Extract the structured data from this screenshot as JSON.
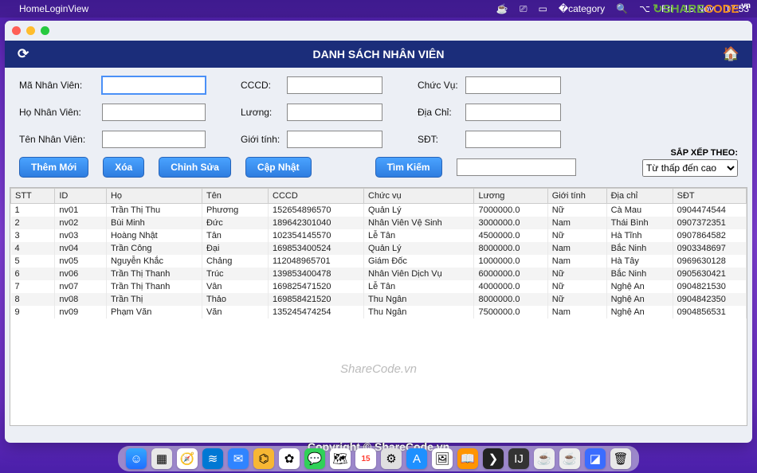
{
  "menubar": {
    "app_name": "HomeLoginView",
    "day": "Fri",
    "date": "15 Nov",
    "time": "17:53"
  },
  "logo": {
    "text1": "SHARE",
    "text2": "CODE",
    "suffix": ".vn"
  },
  "titlebar": {
    "title": "DANH SÁCH NHÂN VIÊN"
  },
  "form": {
    "labels": {
      "ma_nv": "Mã Nhân Viên:",
      "ho_nv": "Họ Nhân Viên:",
      "ten_nv": "Tên Nhân Viên:",
      "cccd": "CCCD:",
      "luong": "Lương:",
      "gioi_tinh": "Giới tính:",
      "chuc_vu": "Chức Vụ:",
      "dia_chi": "Địa Chỉ:",
      "sdt": "SĐT:"
    }
  },
  "buttons": {
    "them_moi": "Thêm Mới",
    "xoa": "Xóa",
    "chinh_sua": "Chỉnh Sửa",
    "cap_nhat": "Cập Nhật",
    "tim_kiem": "Tìm Kiếm"
  },
  "sort": {
    "label": "SẮP XẾP THEO:",
    "selected": "Từ thấp đến cao"
  },
  "table": {
    "headers": [
      "STT",
      "ID",
      "Họ",
      "Tên",
      "CCCD",
      "Chức vụ",
      "Lương",
      "Giới tính",
      "Địa chỉ",
      "SĐT"
    ],
    "rows": [
      [
        "1",
        "nv01",
        "Trần Thị Thu",
        "Phương",
        "152654896570",
        "Quản Lý",
        "7000000.0",
        "Nữ",
        "Cà Mau",
        "0904474544"
      ],
      [
        "2",
        "nv02",
        "Bùi Minh",
        "Đức",
        "189642301040",
        "Nhân Viên Vệ Sinh",
        "3000000.0",
        "Nam",
        "Thái Bình",
        "0907372351"
      ],
      [
        "3",
        "nv03",
        "Hoàng Nhật",
        "Tân",
        "102354145570",
        "Lễ Tân",
        "4500000.0",
        "Nữ",
        "Hà Tĩnh",
        "0907864582"
      ],
      [
        "4",
        "nv04",
        "Trần Công",
        "Đại",
        "169853400524",
        "Quản Lý",
        "8000000.0",
        "Nam",
        "Bắc Ninh",
        "0903348697"
      ],
      [
        "5",
        "nv05",
        "Nguyễn Khắc",
        "Chảng",
        "112048965701",
        "Giám Đốc",
        "1000000.0",
        "Nam",
        "Hà Tây",
        "0969630128"
      ],
      [
        "6",
        "nv06",
        "Trần Thị Thanh",
        "Trúc",
        "139853400478",
        "Nhân Viên Dịch Vụ",
        "6000000.0",
        "Nữ",
        "Bắc Ninh",
        "0905630421"
      ],
      [
        "7",
        "nv07",
        "Trần Thị Thanh",
        "Vân",
        "169825471520",
        "Lễ Tân",
        "4000000.0",
        "Nữ",
        "Nghệ An",
        "0904821530"
      ],
      [
        "8",
        "nv08",
        "Trần Thị",
        "Thảo",
        "169858421520",
        "Thu Ngân",
        "8000000.0",
        "Nữ",
        "Nghệ An",
        "0904842350"
      ],
      [
        "9",
        "nv09",
        "Phạm Văn",
        "Văn",
        "135245474254",
        "Thu Ngân",
        "7500000.0",
        "Nam",
        "Nghệ An",
        "0904856531"
      ]
    ]
  },
  "watermark": "ShareCode.vn",
  "copyright": "Copyright © ShareCode.vn"
}
